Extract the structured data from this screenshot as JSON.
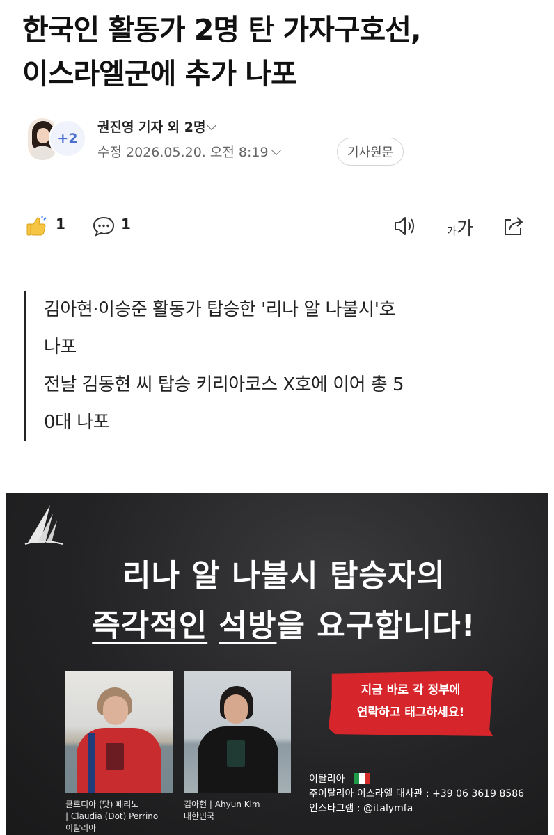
{
  "article": {
    "headline_line1": "한국인 활동가 2명 탄 가자구호선,",
    "headline_line2": "이스라엘군에 추가 나포"
  },
  "byline": {
    "reporter": "권진영 기자 외 2명",
    "extra_reporters_badge": "+2",
    "modified": "수정 2026.05.20. 오전 8:19",
    "original_button": "기사원문"
  },
  "actions": {
    "like_count": "1",
    "comment_count": "1",
    "fontsize_small": "가",
    "fontsize_large": "가"
  },
  "summary": {
    "lines": [
      "김아현·이승준 활동가 탑승한 '리나 알 나불시'호",
      "나포",
      "전날 김동현 씨 탑승 키리아코스 X호에 이어 총 5",
      "0대 나포"
    ]
  },
  "poster": {
    "title_line1": "리나 알 나불시 탑승자의",
    "title_line2_underlined_a": "즉각적인",
    "title_line2_underlined_b": "석방",
    "title_line2_rest": "을 요구합니다!",
    "banner_line1": "지금 바로 각 정부에",
    "banner_line2": "연락하고 태그하세요!",
    "person1_caption_line1": "클로디아 (닷) 페리노",
    "person1_caption_line2": "| Claudia (Dot) Perrino",
    "person1_caption_line3": "이탈리아",
    "person2_caption_line1": "김아현 | Ahyun Kim",
    "person2_caption_line2": "대한민국",
    "contact_country": "이탈리아",
    "contact_embassy": "주이탈리아 이스라엘 대사관 : +39 06 3619 8586",
    "contact_instagram": "인스타그램 : @italymfa"
  },
  "colors": {
    "banner_red": "#d6262b",
    "badge_blue": "#4a6fd1",
    "poster_bg": "#1f1f21"
  }
}
